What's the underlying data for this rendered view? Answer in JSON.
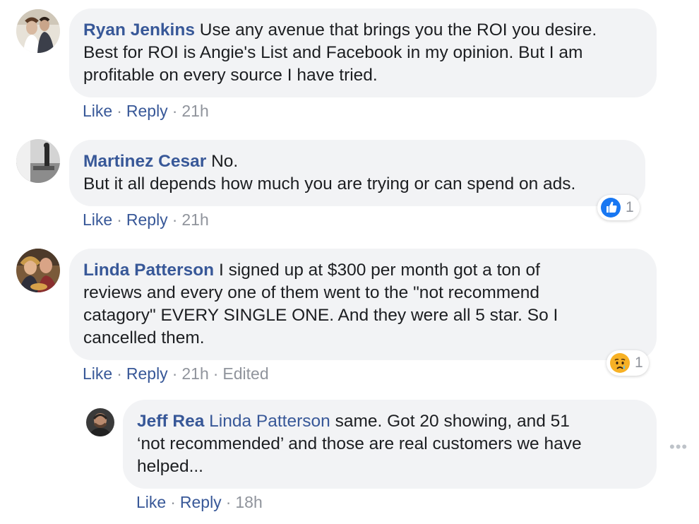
{
  "comments": [
    {
      "author": "Ryan Jenkins",
      "lines": [
        "Use any avenue that brings you the ROI you desire.",
        "Best for ROI is Angie's List and Facebook in my opinion. But I am",
        "profitable on every source I have tried."
      ],
      "actions": {
        "like": "Like",
        "reply": "Reply",
        "time": "21h"
      }
    },
    {
      "author": "Martinez Cesar",
      "lines": [
        "No.",
        "But it all depends how much you are trying or can spend on ads."
      ],
      "actions": {
        "like": "Like",
        "reply": "Reply",
        "time": "21h"
      },
      "reaction": {
        "icon": "like-reaction-icon",
        "count": "1",
        "color": "#1877f2"
      }
    },
    {
      "author": "Linda Patterson",
      "lines": [
        "I signed up at $300 per month got a ton of",
        "reviews and every one of them went to the \"not recommend",
        "catagory\" EVERY SINGLE ONE. And they were all 5 star. So I",
        "cancelled them."
      ],
      "actions": {
        "like": "Like",
        "reply": "Reply",
        "time": "21h",
        "edited": "Edited"
      },
      "reaction": {
        "icon": "sad-reaction-icon",
        "count": "1",
        "color": "#f7b125"
      }
    },
    {
      "author": "Jeff Rea",
      "mention": "Linda Patterson",
      "lines": [
        "same. Got 20 showing, and 51",
        "‘not recommended’ and those are real customers we have",
        "helped..."
      ],
      "actions": {
        "like": "Like",
        "reply": "Reply",
        "time": "18h"
      }
    }
  ],
  "separator": "·",
  "more_options": "•••"
}
